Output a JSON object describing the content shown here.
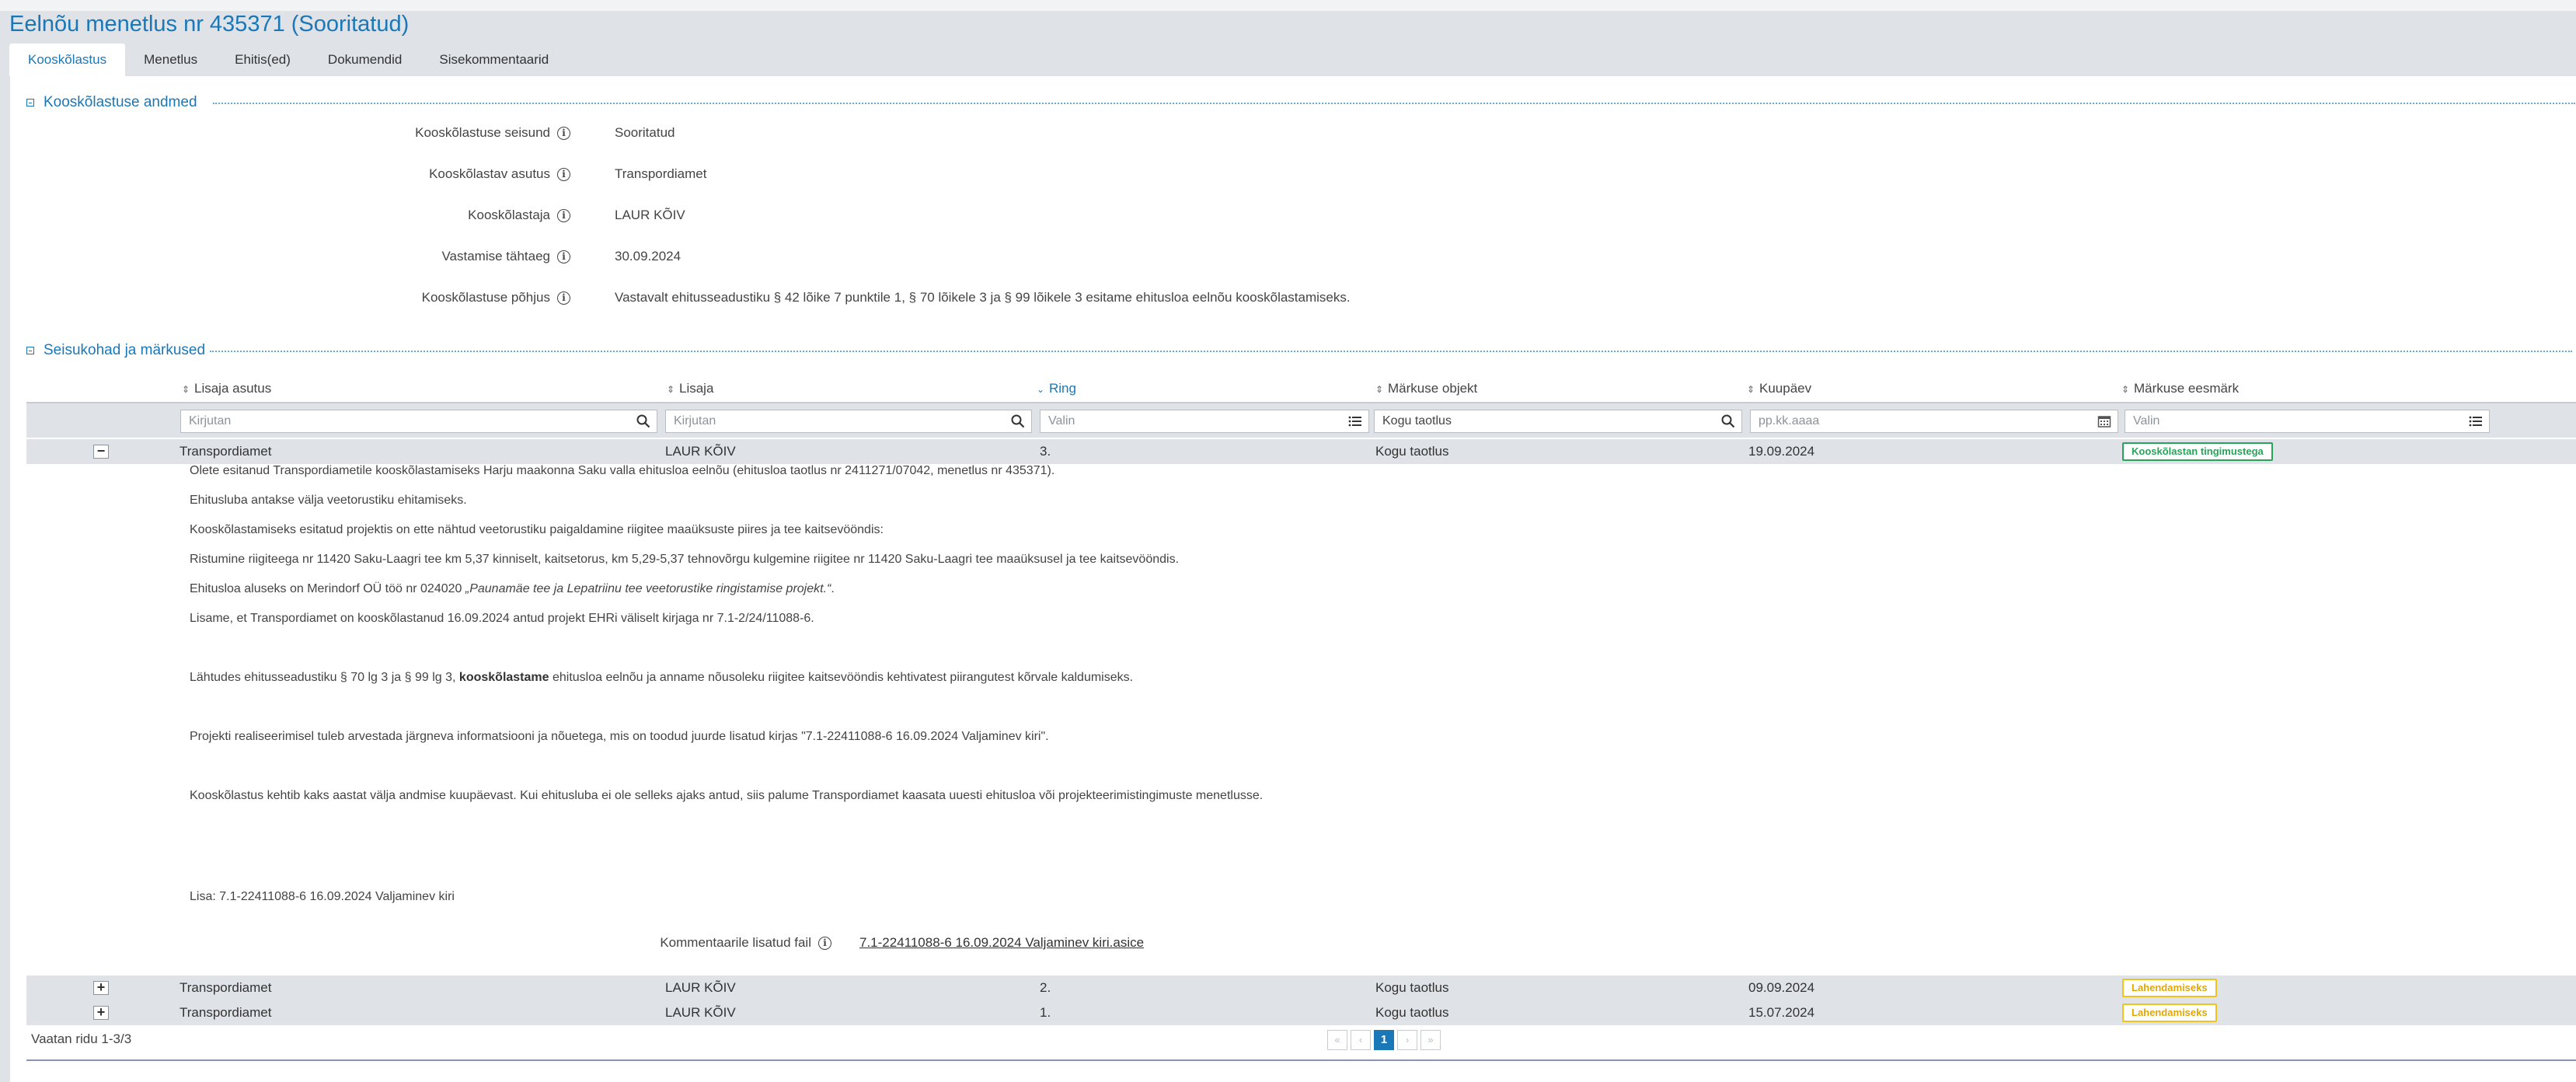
{
  "page": {
    "title": "Eelnõu menetlus nr 435371 (Sooritatud)",
    "tabs": [
      {
        "label": "Kooskõlastus",
        "active": true
      },
      {
        "label": "Menetlus"
      },
      {
        "label": "Ehitis(ed)"
      },
      {
        "label": "Dokumendid"
      },
      {
        "label": "Sisekommentaarid"
      }
    ]
  },
  "details": {
    "section_title": "Kooskõlastuse andmed",
    "fields": [
      {
        "label": "Kooskõlastuse seisund",
        "value": "Sooritatud"
      },
      {
        "label": "Kooskõlastav asutus",
        "value": "Transpordiamet"
      },
      {
        "label": "Kooskõlastaja",
        "value": "LAUR KÕIV"
      },
      {
        "label": "Vastamise tähtaeg",
        "value": "30.09.2024"
      },
      {
        "label": "Kooskõlastuse põhjus",
        "value": "Vastavalt ehitusseadustiku § 42 lõike 7 punktile 1, § 70 lõikele 3 ja § 99 lõikele 3 esitame ehitusloa eelnõu kooskõlastamiseks."
      }
    ]
  },
  "remarks": {
    "section_title": "Seisukohad ja märkused",
    "columns": [
      "Lisaja asutus",
      "Lisaja",
      "Ring",
      "Märkuse objekt",
      "Kuupäev",
      "Märkuse eesmärk"
    ],
    "filters": {
      "org": "Kirjutan",
      "author": "Kirjutan",
      "round": "Valin",
      "object": "Kogu taotlus",
      "date": "pp.kk.aaaa",
      "purpose": "Valin"
    },
    "rows": [
      {
        "org": "Transpordiamet",
        "author": "LAUR KÕIV",
        "round": "3.",
        "object": "Kogu taotlus",
        "date": "19.09.2024",
        "purpose": "Kooskõlastan tingimustega",
        "expanded": true,
        "toggle": "−"
      },
      {
        "org": "Transpordiamet",
        "author": "LAUR KÕIV",
        "round": "2.",
        "object": "Kogu taotlus",
        "date": "09.09.2024",
        "purpose": "Lahendamiseks",
        "toggle": "+"
      },
      {
        "org": "Transpordiamet",
        "author": "LAUR KÕIV",
        "round": "1.",
        "object": "Kogu taotlus",
        "date": "15.07.2024",
        "purpose": "Lahendamiseks",
        "toggle": "+"
      }
    ],
    "comment": {
      "p1": "Olete esitanud Transpordiametile kooskõlastamiseks Harju maakonna Saku valla ehitusloa eelnõu (ehitusloa taotlus nr 2411271/07042, menetlus nr 435371).",
      "p2": "Ehitusluba antakse välja veetorustiku ehitamiseks.",
      "p3": "Kooskõlastamiseks esitatud projektis on ette nähtud veetorustiku paigaldamine riigitee maaüksuste piires ja tee kaitsevööndis:",
      "p4": "Ristumine riigiteega nr 11420 Saku-Laagri tee km 5,37 kinniselt, kaitsetorus, km 5,29-5,37 tehnovõrgu kulgemine riigitee nr 11420 Saku-Laagri tee maaüksusel ja tee kaitsevööndis.",
      "p5_prefix": "Ehitusloa aluseks on Merindorf OÜ töö nr 024020 ",
      "p5_italic": "„Paunamäe tee ja Lepatriinu tee veetorustike ringistamise projekt.“",
      "p5_suffix": ".",
      "p6": "Lisame, et Transpordiamet on kooskõlastanud 16.09.2024 antud projekt EHRi väliselt kirjaga nr 7.1-2/24/11088-6.",
      "p7_prefix": "Lähtudes ehitusseadustiku § 70 lg 3 ja § 99 lg 3, ",
      "p7_bold": "kooskõlastame",
      "p7_suffix": " ehitusloa eelnõu ja anname nõusoleku riigitee kaitsevööndis kehtivatest piirangutest kõrvale kaldumiseks.",
      "p8": "Projekti realiseerimisel tuleb arvestada järgneva informatsiooni ja nõuetega, mis on toodud juurde lisatud kirjas \"7.1-22411088-6 16.09.2024 Valjaminev kiri\".",
      "p9": "Kooskõlastus kehtib kaks aastat välja andmise kuupäevast. Kui ehitusluba ei ole selleks ajaks antud, siis palume Transpordiamet kaasata uuesti ehitusloa või projekteerimistingimuste menetlusse.",
      "p10": "Lisa: 7.1-22411088-6 16.09.2024 Valjaminev kiri",
      "attachment_label": "Kommentaarile lisatud fail",
      "attachment_file": "7.1-22411088-6 16.09.2024 Valjaminev kiri.asice"
    },
    "footer_text": "Vaatan ridu 1-3/3",
    "pager": {
      "first": "«",
      "prev": "‹",
      "current": "1",
      "next": "›",
      "last": "»"
    }
  },
  "colors": {
    "accent": "#1a78b8",
    "approved": "#27a35a",
    "pending": "#f0c419",
    "header_bg": "#dfe2e7"
  },
  "icons": [
    "info-icon",
    "search-icon",
    "list-icon",
    "calendar-icon",
    "sort-icon",
    "collapse-icon",
    "expand-icon"
  ]
}
